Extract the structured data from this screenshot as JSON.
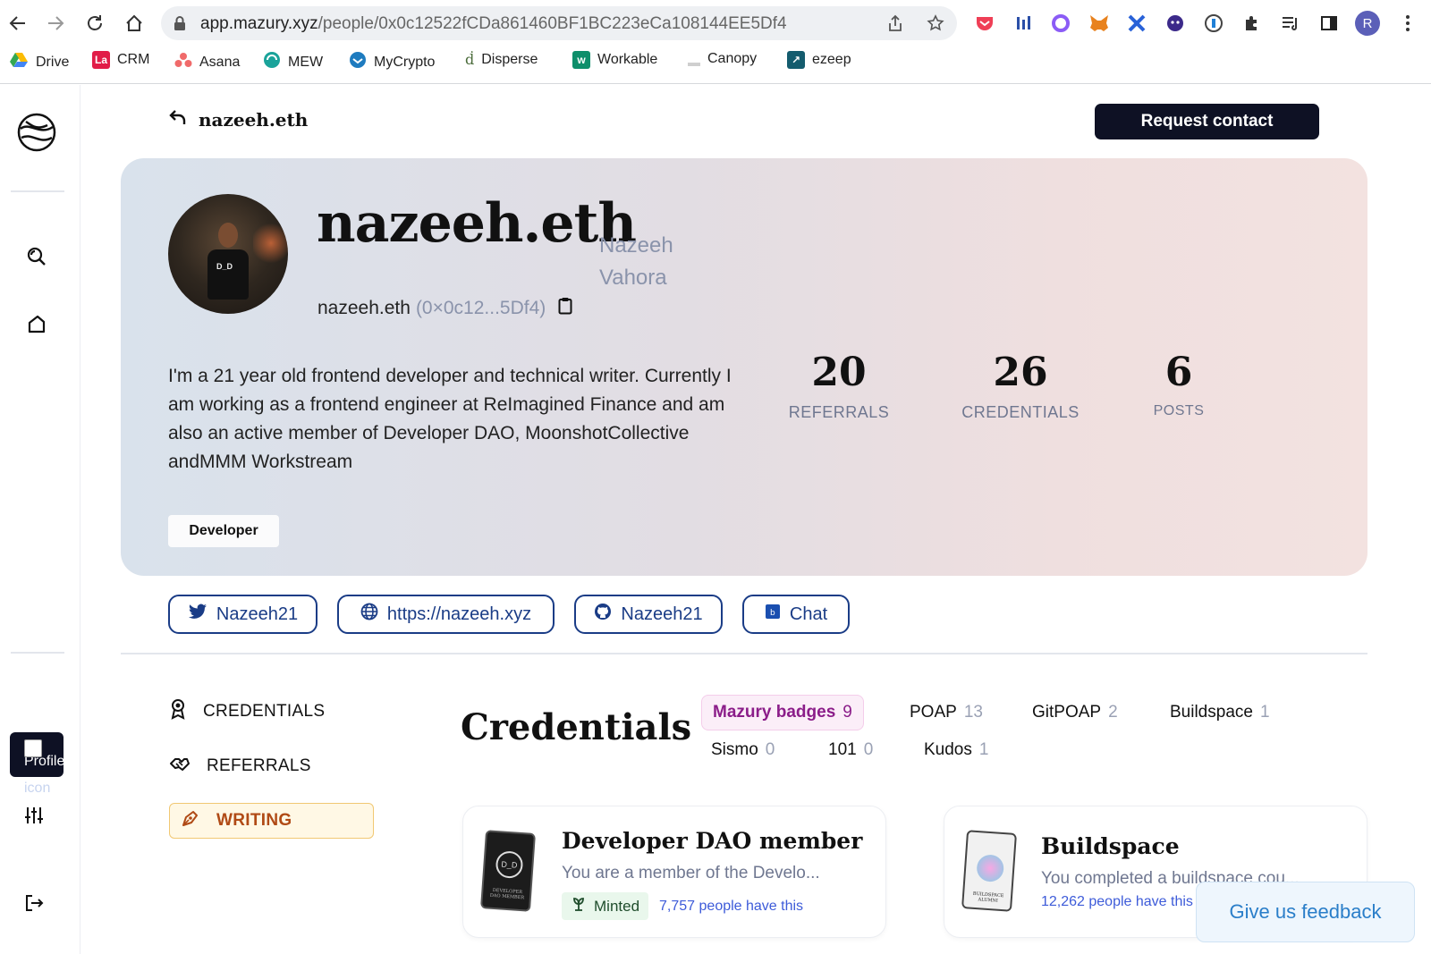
{
  "browser": {
    "url_host": "app.mazury.xyz",
    "url_path": "/people/0x0c12522fCDa861460BF1BC223eCa108144EE5Df4",
    "bookmarks": [
      {
        "label": "Drive",
        "color": "#34a853"
      },
      {
        "label": "CRM",
        "color": "#e11d48"
      },
      {
        "label": "Asana",
        "color": "#f06a6a"
      },
      {
        "label": "MEW",
        "color": "#1aa39a"
      },
      {
        "label": "MyCrypto",
        "color": "#1e7bbf"
      },
      {
        "label": "Disperse",
        "color": "#4a6b3a"
      },
      {
        "label": "Workable",
        "color": "#0e8f6b"
      },
      {
        "label": "Canopy",
        "color": "#a3a3a3"
      },
      {
        "label": "ezeep",
        "color": "#145c6e"
      }
    ],
    "profile_initial": "R"
  },
  "sidebar": {
    "profile_alt_line1": "Profile",
    "profile_alt_line2": "icon"
  },
  "header": {
    "back_label": "nazeeh.eth",
    "request_button": "Request contact"
  },
  "profile": {
    "username": "nazeeh.eth",
    "real_name": "Nazeeh Vahora",
    "handle": "nazeeh.eth",
    "address_short": "(0×0c12...5Df4)",
    "bio": "I'm a 21 year old frontend developer and technical writer. Currently I am working as a frontend engineer at ReImagined Finance and am also an active member of Developer DAO, MoonshotCollective andMMM Workstream",
    "tag": "Developer",
    "stats": [
      {
        "value": "20",
        "label": "REFERRALS"
      },
      {
        "value": "26",
        "label": "CREDENTIALS"
      },
      {
        "value": "6",
        "label": "POSTS"
      }
    ],
    "avatar_shirt_text": "D_D"
  },
  "links": [
    {
      "label": "Nazeeh21",
      "icon": "twitter-icon"
    },
    {
      "label": "https://nazeeh.xyz",
      "icon": "globe-icon"
    },
    {
      "label": "Nazeeh21",
      "icon": "github-icon"
    },
    {
      "label": "Chat",
      "icon": "chat-icon"
    }
  ],
  "menu": [
    {
      "label": "CREDENTIALS",
      "icon": "badge-icon"
    },
    {
      "label": "REFERRALS",
      "icon": "handshake-icon"
    },
    {
      "label": "WRITING",
      "icon": "pen-icon",
      "active": true
    }
  ],
  "credentials": {
    "title": "Credentials",
    "tabs": [
      {
        "label": "Mazury badges",
        "count": "9",
        "active": true
      },
      {
        "label": "POAP",
        "count": "13"
      },
      {
        "label": "GitPOAP",
        "count": "2"
      },
      {
        "label": "Buildspace",
        "count": "1"
      },
      {
        "label": "Sismo",
        "count": "0"
      },
      {
        "label": "101",
        "count": "0"
      },
      {
        "label": "Kudos",
        "count": "1"
      }
    ],
    "cards": [
      {
        "title": "Developer DAO member",
        "desc": "You are a member of the Develo...",
        "status": "Minted",
        "have": "7,757 people have this",
        "thumb_text": "D_D",
        "thumb_caption": "DEVELOPER DAO MEMBER"
      },
      {
        "title": "Buildspace",
        "desc": "You completed a buildspace cou...",
        "have": "12,262 people have this",
        "thumb_caption": "BUILDSPACE ALUMNI"
      }
    ]
  },
  "feedback": "Give us feedback"
}
